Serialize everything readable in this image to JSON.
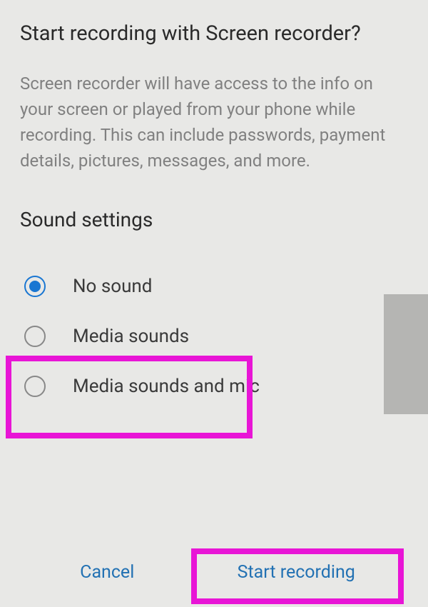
{
  "dialog": {
    "title": "Start recording with Screen recorder?",
    "description": "Screen recorder will have access to the info on your screen or played from your phone while recording. This can include passwords, payment details, pictures, messages, and more."
  },
  "section": {
    "heading": "Sound settings",
    "options": [
      {
        "label": "No sound",
        "selected": true
      },
      {
        "label": "Media sounds",
        "selected": false
      },
      {
        "label": "Media sounds and mic",
        "selected": false
      }
    ]
  },
  "buttons": {
    "cancel": "Cancel",
    "start": "Start recording"
  }
}
